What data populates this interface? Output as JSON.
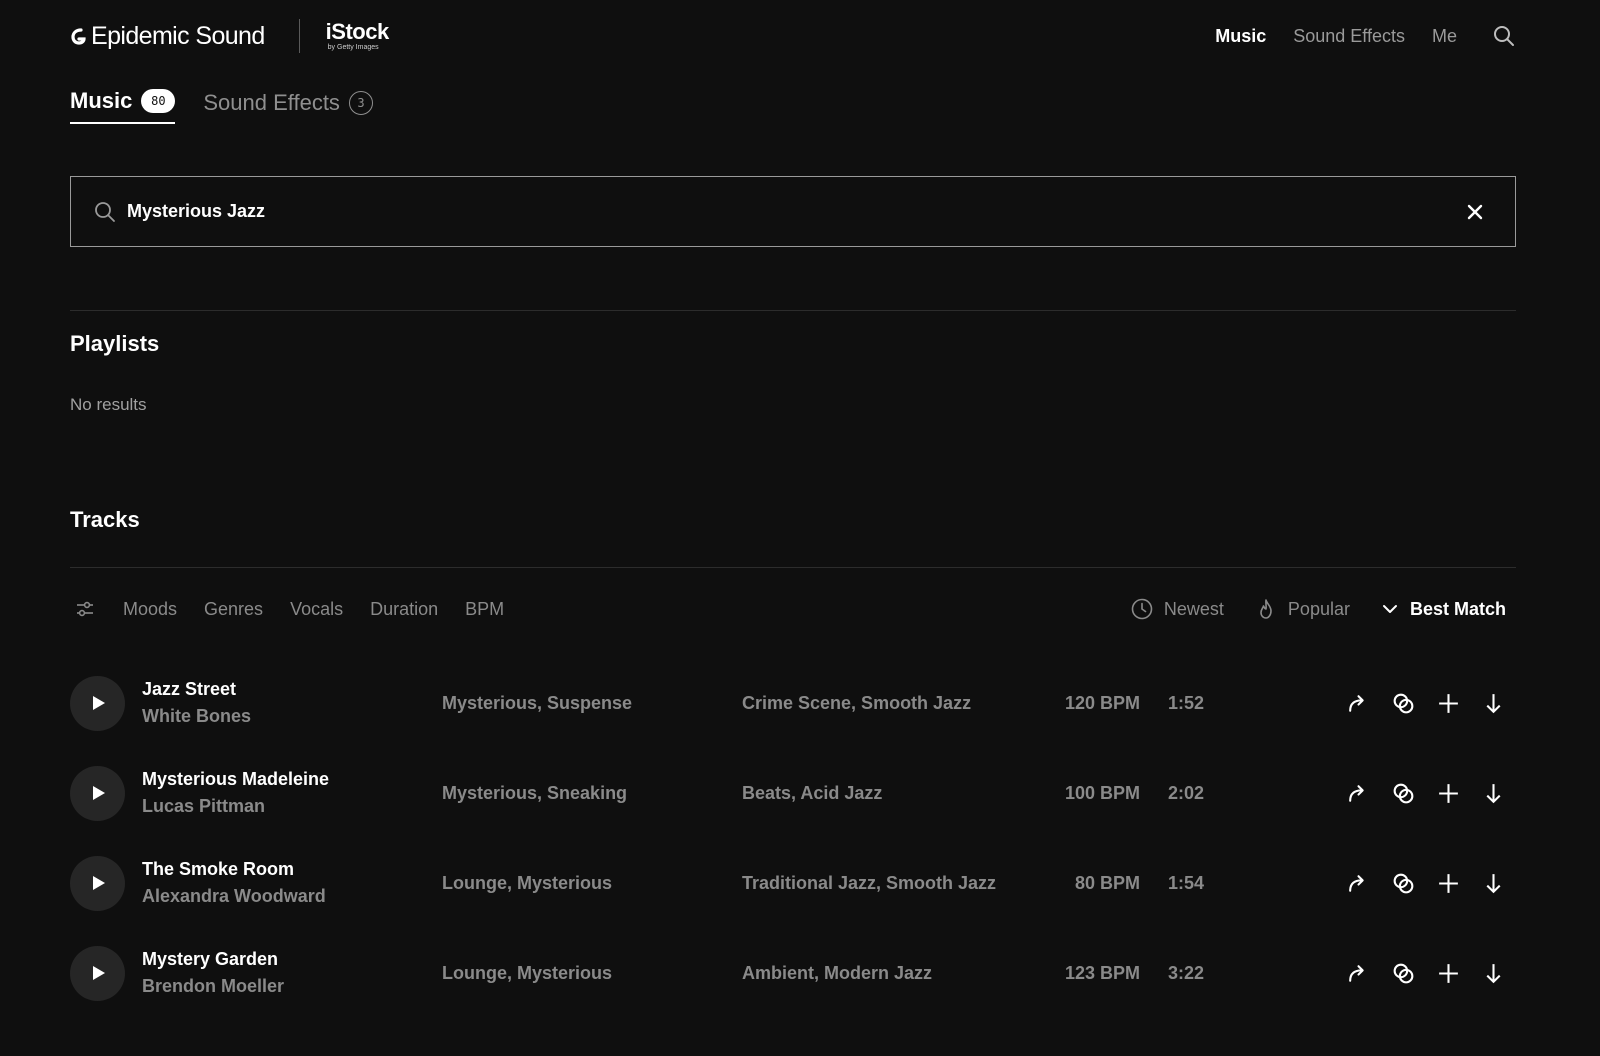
{
  "header": {
    "logo_text": "Epidemic Sound",
    "partner_name": "iStock",
    "partner_sub": "by Getty Images",
    "nav": [
      {
        "label": "Music",
        "active": true
      },
      {
        "label": "Sound Effects",
        "active": false
      },
      {
        "label": "Me",
        "active": false
      }
    ]
  },
  "tabs": [
    {
      "label": "Music",
      "count": "80",
      "active": true
    },
    {
      "label": "Sound Effects",
      "count": "3",
      "active": false
    }
  ],
  "search": {
    "value": "Mysterious Jazz"
  },
  "playlists": {
    "title": "Playlists",
    "empty_text": "No results"
  },
  "tracks_section": {
    "title": "Tracks",
    "filters": [
      "Moods",
      "Genres",
      "Vocals",
      "Duration",
      "BPM"
    ],
    "sorts": [
      {
        "label": "Newest",
        "icon": "clock-icon",
        "active": false
      },
      {
        "label": "Popular",
        "icon": "flame-icon",
        "active": false
      },
      {
        "label": "Best Match",
        "icon": "chevron-down-icon",
        "active": true
      }
    ]
  },
  "tracks": [
    {
      "title": "Jazz Street",
      "artist": "White Bones",
      "moods": "Mysterious, Suspense",
      "genres": "Crime Scene, Smooth Jazz",
      "bpm": "120 BPM",
      "duration": "1:52"
    },
    {
      "title": "Mysterious Madeleine",
      "artist": "Lucas Pittman",
      "moods": "Mysterious, Sneaking",
      "genres": "Beats, Acid Jazz",
      "bpm": "100 BPM",
      "duration": "2:02"
    },
    {
      "title": "The Smoke Room",
      "artist": "Alexandra Woodward",
      "moods": "Lounge, Mysterious",
      "genres": "Traditional Jazz, Smooth Jazz",
      "bpm": "80 BPM",
      "duration": "1:54"
    },
    {
      "title": "Mystery Garden",
      "artist": "Brendon Moeller",
      "moods": "Lounge, Mysterious",
      "genres": "Ambient, Modern Jazz",
      "bpm": "123 BPM",
      "duration": "3:22"
    }
  ],
  "colors": {
    "background": "#0f0f0f",
    "text": "#ffffff",
    "muted": "#8a8a8a",
    "play_button": "#262626"
  }
}
